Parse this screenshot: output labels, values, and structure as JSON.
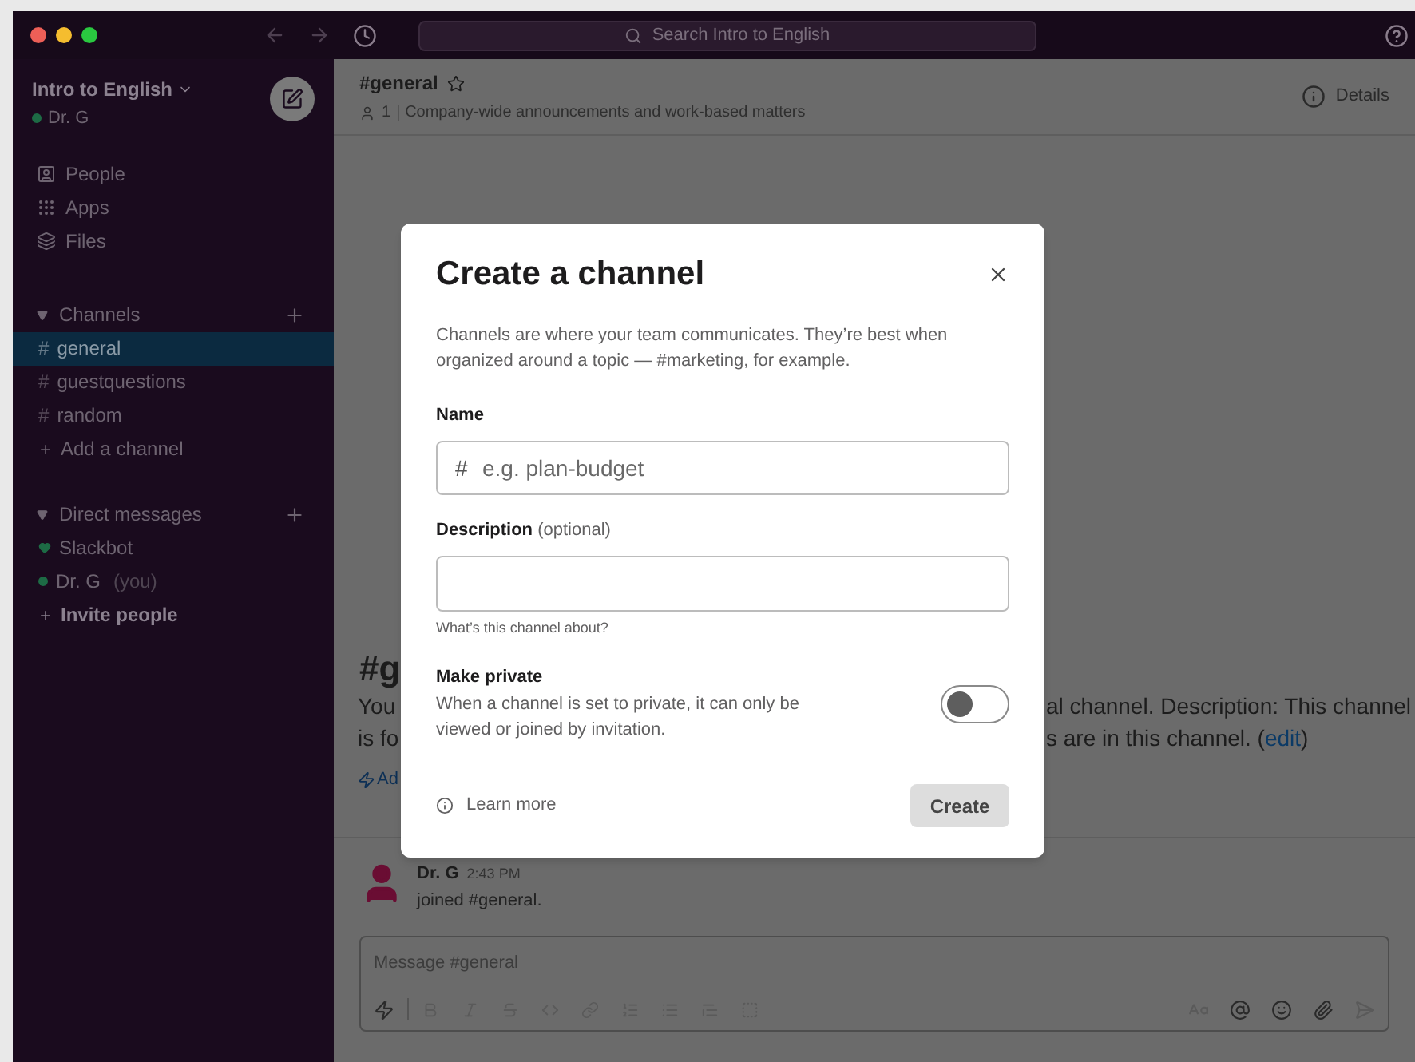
{
  "toolbar": {
    "search_placeholder": "Search Intro to English"
  },
  "sidebar": {
    "workspace": "Intro to English",
    "user": "Dr. G",
    "nav": [
      {
        "label": "People",
        "kind": "people"
      },
      {
        "label": "Apps",
        "kind": "apps"
      },
      {
        "label": "Files",
        "kind": "files"
      }
    ],
    "channels": {
      "title": "Channels",
      "expanded": true,
      "items": [
        {
          "prefix": "#",
          "label": "general",
          "selected": true
        },
        {
          "prefix": "#",
          "label": "guestquestions",
          "selected": false
        },
        {
          "prefix": "#",
          "label": "random",
          "selected": false
        }
      ],
      "add": "Add a channel"
    },
    "direct_messages": {
      "title": "Direct messages",
      "expanded": true,
      "items": [
        {
          "name": "Slackbot",
          "kind": "bot"
        },
        {
          "name": "Dr. G",
          "suffix": "(you)",
          "kind": "user"
        }
      ],
      "invite": "Invite people"
    }
  },
  "header": {
    "channel": "#general",
    "members": "1",
    "topic": "Company-wide announcements and work-based matters",
    "details": "Details"
  },
  "intro": {
    "heading": "#g",
    "lines": [
      {
        "left": "You",
        "right": "al channel. Description: This channel"
      },
      {
        "left": "is fo",
        "right": "s are in this channel. (",
        "link": "edit",
        "after": ")"
      },
      {
        "left": "Ad",
        "kind": "action"
      }
    ]
  },
  "message": {
    "author": "Dr. G",
    "time": "2:43 PM",
    "text": "joined #general."
  },
  "composer": {
    "placeholder": "Message #general"
  },
  "modal": {
    "title": "Create a channel",
    "description": "Channels are where your team communicates. They’re best when organized around a topic — #marketing, for example.",
    "name_label": "Name",
    "name_prefix": "#",
    "name_placeholder": "e.g. plan-budget",
    "description_label": "Description",
    "description_optional": "(optional)",
    "description_hint": "What’s this channel about?",
    "private_label": "Make private",
    "private_text": "When a channel is set to private, it can only be viewed or joined by invitation.",
    "private_on": false,
    "learn_more": "Learn more",
    "create": "Create"
  }
}
